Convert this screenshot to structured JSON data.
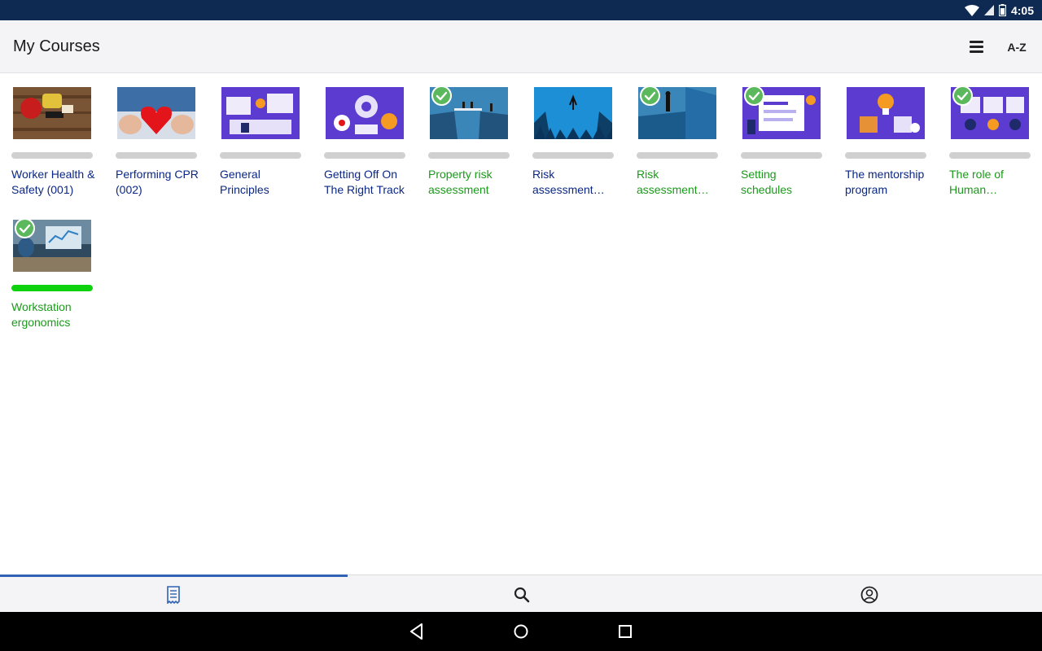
{
  "status": {
    "time": "4:05"
  },
  "header": {
    "title": "My Courses",
    "sort_label": "A-Z"
  },
  "colors": {
    "accent": "#2f62b5",
    "title_blue": "#0b2785",
    "complete_green": "#1a9a1a",
    "progress_green": "#0fd20f",
    "status_bar": "#0f2a52"
  },
  "courses": [
    {
      "title": "Worker Health & Safety (001)",
      "completed": false,
      "progress": 0,
      "thumb": "safety-gear"
    },
    {
      "title": "Performing CPR (002)",
      "completed": false,
      "progress": 0,
      "thumb": "heart-hands"
    },
    {
      "title": "General Principles",
      "completed": false,
      "progress": 0,
      "thumb": "purple-illustration"
    },
    {
      "title": "Getting Off On The Right Track",
      "completed": false,
      "progress": 0,
      "thumb": "purple-gears"
    },
    {
      "title": "Property risk assessment",
      "completed": true,
      "progress": 0,
      "thumb": "bridge-cliff"
    },
    {
      "title": "Risk assessment…",
      "completed": false,
      "progress": 0,
      "thumb": "tightrope-sky"
    },
    {
      "title": "Risk assessment…",
      "completed": true,
      "progress": 0,
      "thumb": "businessman-cliff"
    },
    {
      "title": "Setting schedules",
      "completed": true,
      "progress": 0,
      "thumb": "purple-schedule"
    },
    {
      "title": "The mentorship program",
      "completed": false,
      "progress": 0,
      "thumb": "purple-lightbulb"
    },
    {
      "title": "The role of Human…",
      "completed": true,
      "progress": 0,
      "thumb": "purple-people"
    },
    {
      "title": "Workstation ergonomics",
      "completed": true,
      "progress": 1.0,
      "thumb": "office-desk"
    }
  ],
  "nav": {
    "tabs": [
      {
        "icon": "courses-list-icon"
      },
      {
        "icon": "search-icon"
      },
      {
        "icon": "profile-icon"
      }
    ],
    "active_index": 0
  },
  "system_nav": [
    "back-icon",
    "home-icon",
    "recents-icon"
  ]
}
